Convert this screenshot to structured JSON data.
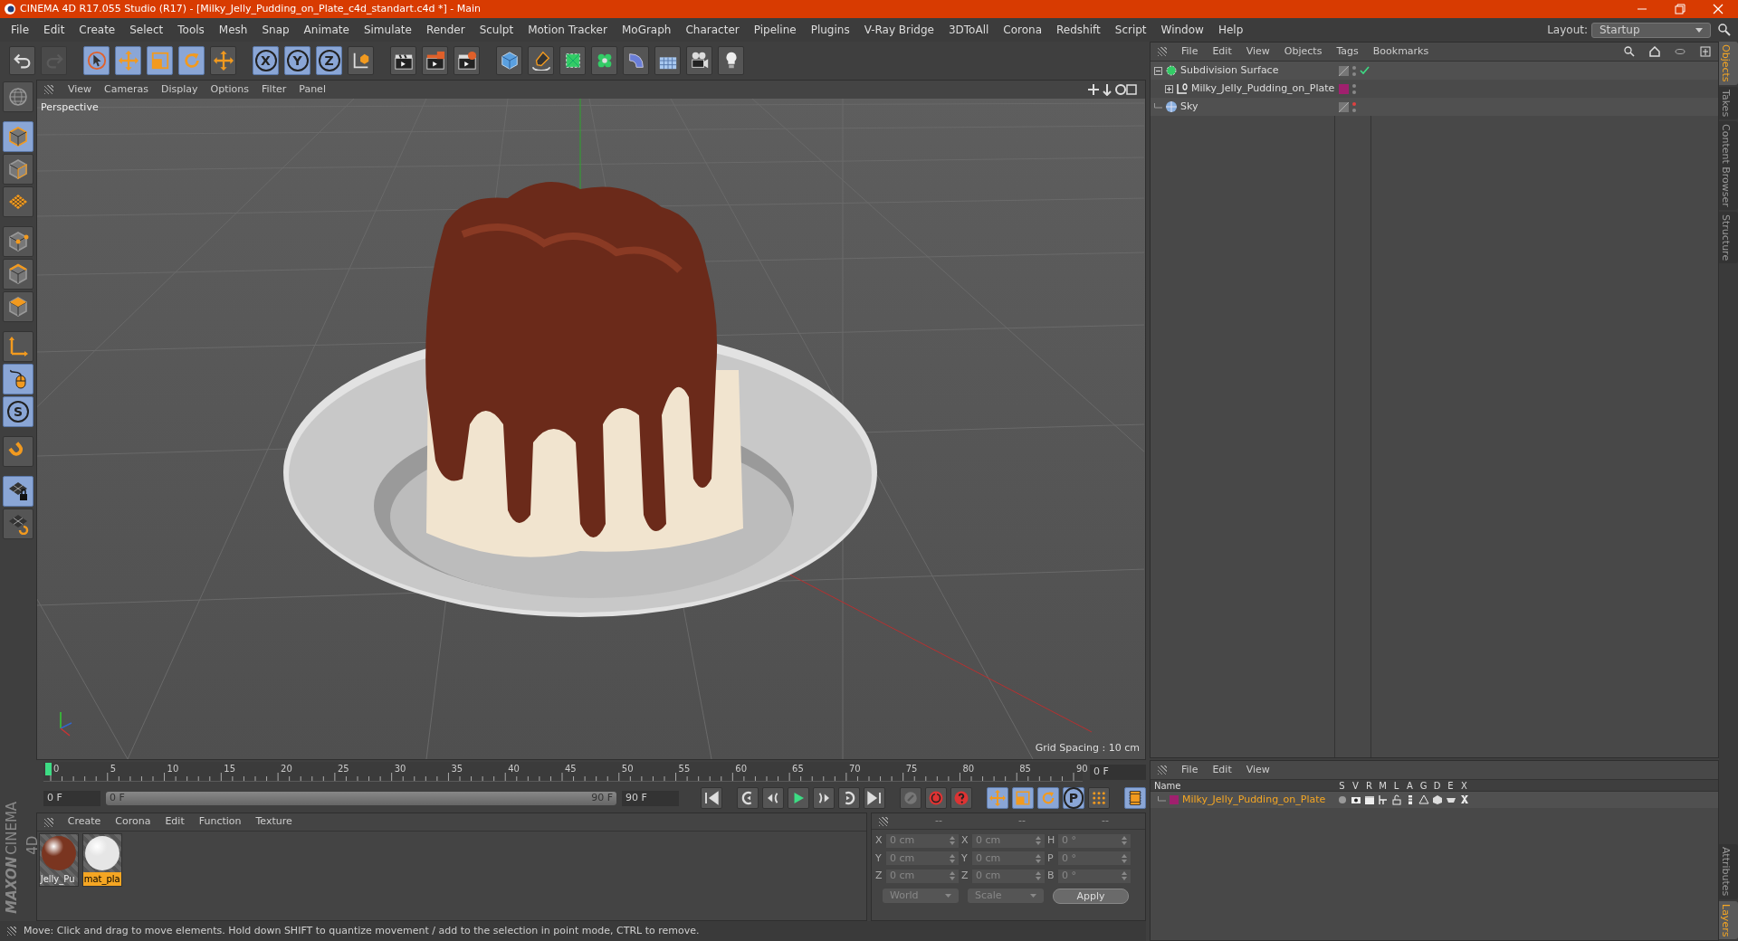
{
  "window": {
    "title": "CINEMA 4D R17.055 Studio (R17) - [Milky_Jelly_Pudding_on_Plate_c4d_standart.c4d *] - Main"
  },
  "menu": [
    "File",
    "Edit",
    "Create",
    "Select",
    "Tools",
    "Mesh",
    "Snap",
    "Animate",
    "Simulate",
    "Render",
    "Sculpt",
    "Motion Tracker",
    "MoGraph",
    "Character",
    "Pipeline",
    "Plugins",
    "V-Ray Bridge",
    "3DToAll",
    "Corona",
    "Redshift",
    "Script",
    "Window",
    "Help"
  ],
  "layout": {
    "label": "Layout:",
    "value": "Startup"
  },
  "toolbar": [
    {
      "active": false,
      "disabled": false
    },
    {
      "active": false,
      "disabled": true
    },
    {
      "active": true,
      "disabled": false
    },
    {
      "active": true,
      "disabled": false
    },
    {
      "active": true,
      "disabled": false
    },
    {
      "active": true,
      "disabled": false
    },
    {
      "active": false,
      "disabled": false
    },
    {
      "label": "X",
      "active": true,
      "disabled": false
    },
    {
      "label": "Y",
      "active": true,
      "disabled": false
    },
    {
      "label": "Z",
      "active": true,
      "disabled": false
    },
    {
      "active": false,
      "disabled": false
    },
    {
      "active": false,
      "disabled": false
    },
    {
      "active": false,
      "disabled": false
    },
    {
      "active": false,
      "disabled": false
    },
    {
      "active": false,
      "disabled": false
    },
    {
      "active": false,
      "disabled": false
    },
    {
      "active": false,
      "disabled": false
    },
    {
      "active": false,
      "disabled": false
    },
    {
      "active": false,
      "disabled": false
    },
    {
      "active": false,
      "disabled": false
    },
    {
      "active": false,
      "disabled": false
    },
    {
      "active": false,
      "disabled": false
    }
  ],
  "tools": [
    {
      "active": false
    },
    {
      "active": true
    },
    {
      "active": false
    },
    {
      "active": false
    },
    {
      "active": false
    },
    {
      "active": false
    },
    {
      "active": false
    },
    {
      "active": false
    },
    {
      "active": true
    },
    {
      "label": "S",
      "active": true
    },
    {
      "active": false
    },
    {
      "active": true
    },
    {
      "active": false
    }
  ],
  "viewport": {
    "menu": [
      "View",
      "Cameras",
      "Display",
      "Options",
      "Filter",
      "Panel"
    ],
    "camera": "Perspective",
    "grid_spacing": "Grid Spacing : 10 cm"
  },
  "timeline": {
    "ticks": [
      "0",
      "5",
      "10",
      "15",
      "20",
      "25",
      "30",
      "35",
      "40",
      "45",
      "50",
      "55",
      "60",
      "65",
      "70",
      "75",
      "80",
      "85",
      "90"
    ],
    "level": 0,
    "current": "0 F",
    "start": "0 F",
    "range": {
      "start": "0 F",
      "end": "90 F",
      "level": 1
    },
    "end": "90 F"
  },
  "transport": [
    {
      "active": false
    },
    {
      "active": false
    },
    {
      "active": false
    },
    {
      "active": false
    },
    {
      "active": false
    },
    {
      "active": false
    },
    {
      "active": false
    },
    {
      "active": false
    },
    {
      "active": false
    },
    {
      "active": false
    },
    {
      "active": true
    },
    {
      "active": true
    },
    {
      "active": true
    },
    {
      "label": "P",
      "active": true
    },
    {
      "active": false
    },
    {
      "active": true
    }
  ],
  "materials": {
    "menu": [
      "Create",
      "Corona",
      "Edit",
      "Function",
      "Texture"
    ],
    "items": [
      {
        "name": "Jelly_Pu",
        "selected": false,
        "color": "#7a3520"
      },
      {
        "name": "mat_pla",
        "selected": true,
        "color": "#e6e6e6"
      }
    ]
  },
  "brand": {
    "company": "MAXON",
    "product": "CINEMA 4D"
  },
  "coordinates": {
    "headers": [
      "--",
      "--",
      "--"
    ],
    "rows": [
      {
        "axis": "X",
        "position": "0 cm",
        "size_axis": "X",
        "size": "0 cm",
        "rot_axis": "H",
        "rotation": "0 °"
      },
      {
        "axis": "Y",
        "position": "0 cm",
        "size_axis": "Y",
        "size": "0 cm",
        "rot_axis": "P",
        "rotation": "0 °"
      },
      {
        "axis": "Z",
        "position": "0 cm",
        "size_axis": "Z",
        "size": "0 cm",
        "rot_axis": "B",
        "rotation": "0 °"
      }
    ],
    "mode": "World",
    "transform": "Scale",
    "apply": "Apply"
  },
  "status_bar": "Move: Click and drag to move elements. Hold down SHIFT to quantize movement / add to the selection in point mode, CTRL to remove.",
  "objects_panel": {
    "menu": [
      "File",
      "Edit",
      "View",
      "Objects",
      "Tags",
      "Bookmarks"
    ],
    "objects": [
      {
        "name": "Subdivision Surface",
        "kind": "subdivision",
        "expanded": true,
        "enabled": true,
        "editor_visible": true,
        "children": [
          {
            "name": "Milky_Jelly_Pudding_on_Plate",
            "kind": "null",
            "expanded": false,
            "editor_visible": true,
            "color": "#a0206e"
          }
        ]
      },
      {
        "name": "Sky",
        "kind": "sky",
        "editor_visible": false
      }
    ]
  },
  "layers_panel": {
    "menu": [
      "File",
      "Edit",
      "View"
    ],
    "columns": [
      "Name",
      "S",
      "V",
      "R",
      "M",
      "L",
      "A",
      "G",
      "D",
      "E",
      "X"
    ],
    "layers": [
      {
        "name": "Milky_Jelly_Pudding_on_Plate",
        "color": "#a0206e"
      }
    ]
  },
  "side_tabs": [
    {
      "label": "Objects",
      "selected": true
    },
    {
      "label": "Takes",
      "selected": false
    },
    {
      "label": "Content Browser",
      "selected": false
    },
    {
      "label": "Structure",
      "selected": false
    }
  ],
  "side_tabs_bottom": [
    {
      "label": "Attributes",
      "selected": false
    },
    {
      "label": "Layers",
      "selected": true
    }
  ]
}
